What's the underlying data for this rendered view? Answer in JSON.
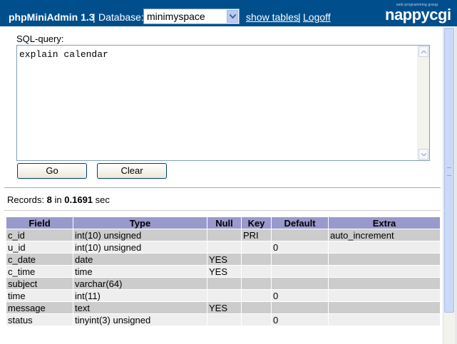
{
  "header": {
    "app_title": "phpMiniAdmin 1.3",
    "separator": "|",
    "db_label": "Database:",
    "db_selected": "minimyspace",
    "show_tables": "show tables",
    "logoff": "Logoff",
    "logo_tagline": "web programming group",
    "logo_brand": "nappycgi"
  },
  "query": {
    "label": "SQL-query:",
    "text": "explain calendar",
    "go_label": "Go",
    "clear_label": "Clear"
  },
  "records": {
    "prefix": "Records:",
    "count": "8",
    "in": "in",
    "time": "0.1691",
    "unit": "sec"
  },
  "table": {
    "columns": [
      "Field",
      "Type",
      "Null",
      "Key",
      "Default",
      "Extra"
    ],
    "rows": [
      [
        "c_id",
        "int(10) unsigned",
        "",
        "PRI",
        "",
        "auto_increment"
      ],
      [
        "u_id",
        "int(10) unsigned",
        "",
        "",
        "0",
        ""
      ],
      [
        "c_date",
        "date",
        "YES",
        "",
        "",
        ""
      ],
      [
        "c_time",
        "time",
        "YES",
        "",
        "",
        ""
      ],
      [
        "subject",
        "varchar(64)",
        "",
        "",
        "",
        ""
      ],
      [
        "time",
        "int(11)",
        "",
        "",
        "0",
        ""
      ],
      [
        "message",
        "text",
        "YES",
        "",
        "",
        ""
      ],
      [
        "status",
        "tinyint(3) unsigned",
        "",
        "",
        "0",
        ""
      ]
    ]
  },
  "colors": {
    "header_bg": "#004f8c",
    "table_header_bg": "#9999cc",
    "row_odd_bg": "#cccccc",
    "row_even_bg": "#eeeeee"
  }
}
